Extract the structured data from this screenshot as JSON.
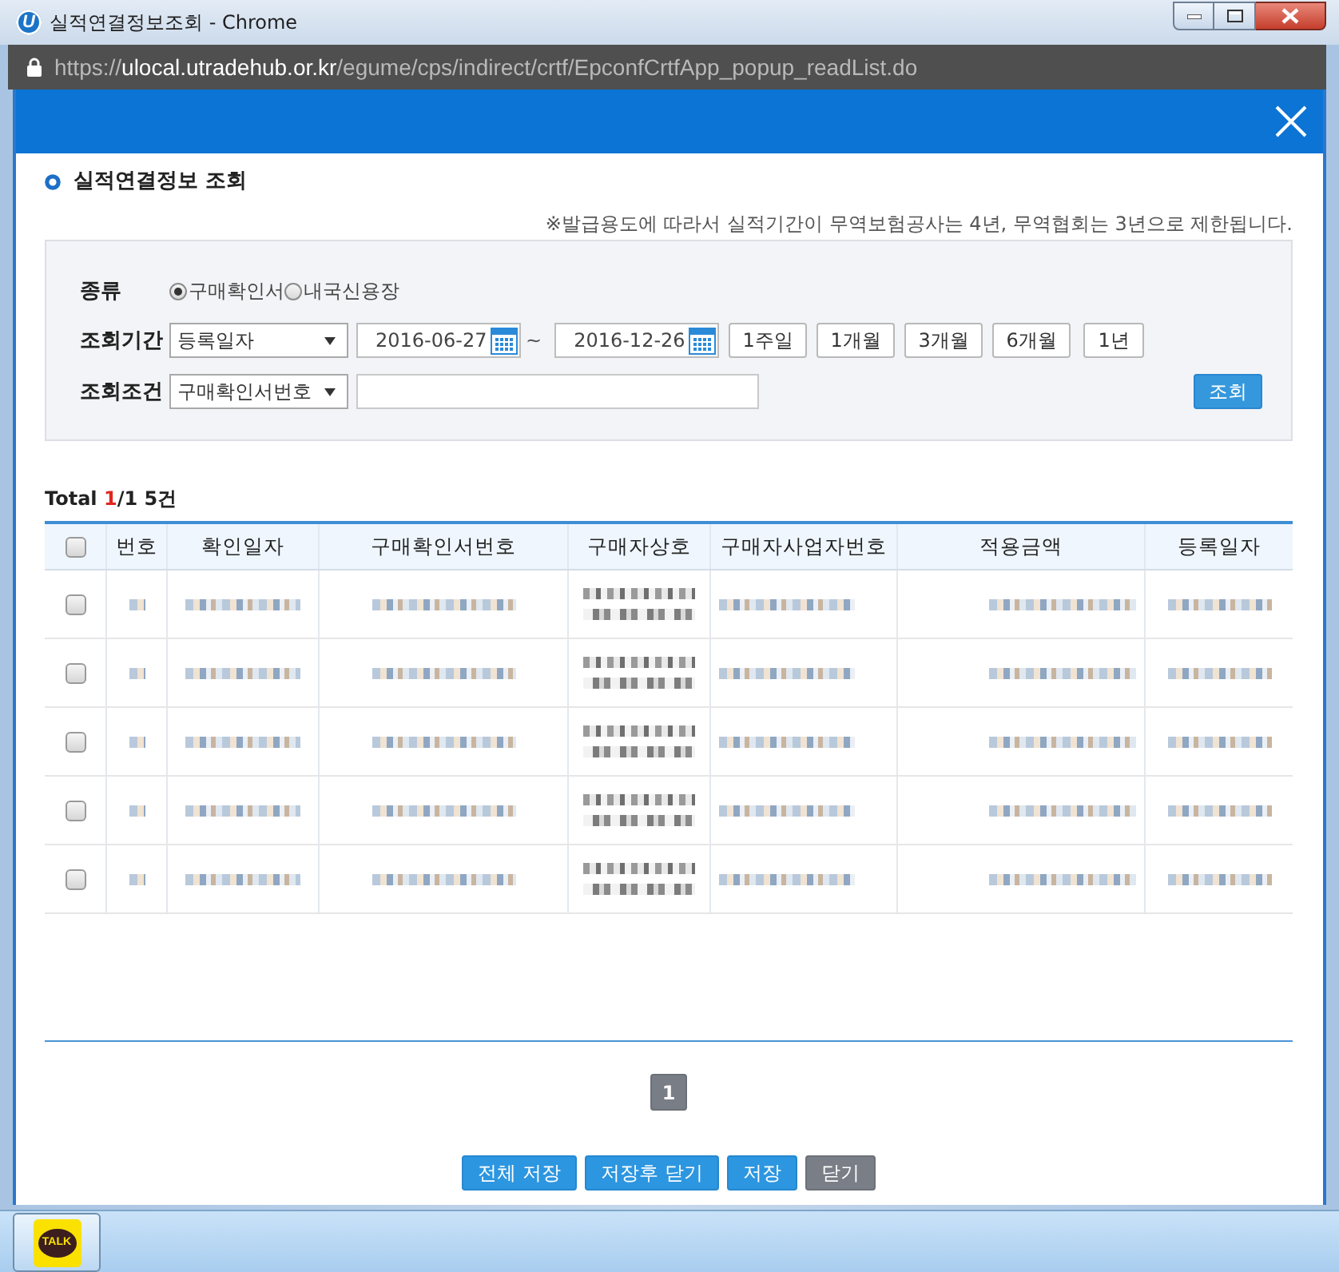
{
  "window": {
    "icon_text": "U",
    "title": "실적연결정보조회 - Chrome"
  },
  "address_bar": {
    "scheme": "https://",
    "host": "ulocal.utradehub.or.kr",
    "path": "/egume/cps/indirect/crtf/EpconfCrtfApp_popup_readList.do"
  },
  "section_title": "실적연결정보 조회",
  "notice": "※발급용도에 따라서 실적기간이 무역보험공사는 4년, 무역협회는 3년으로 제한됩니다.",
  "search": {
    "type": {
      "label": "종류",
      "options": [
        {
          "label": "구매확인서",
          "selected": true
        },
        {
          "label": "내국신용장",
          "selected": false
        }
      ]
    },
    "period": {
      "label": "조회기간",
      "select": "등록일자",
      "from": "2016-06-27",
      "separator": "~",
      "to": "2016-12-26",
      "quick_buttons": [
        "1주일",
        "1개월",
        "3개월",
        "6개월",
        "1년"
      ]
    },
    "condition": {
      "label": "조회조건",
      "select": "구매확인서번호"
    },
    "submit": "조회"
  },
  "result_count": {
    "prefix": "Total",
    "current_page": "1",
    "rest": "/1 5건"
  },
  "table": {
    "select_all": {
      "checked": false
    },
    "columns": [
      "번호",
      "확인일자",
      "구매확인서번호",
      "구매자상호",
      "구매자사업자번호",
      "적용금액",
      "등록일자"
    ],
    "rows": [
      {
        "checked": false
      },
      {
        "checked": false
      },
      {
        "checked": false
      },
      {
        "checked": false
      },
      {
        "checked": false
      }
    ]
  },
  "pagination": {
    "pages": [
      {
        "label": "1",
        "selected": true
      }
    ]
  },
  "buttons": [
    {
      "label": "전체 저장",
      "kind": "primary"
    },
    {
      "label": "저장후 닫기",
      "kind": "primary"
    },
    {
      "label": "저장",
      "kind": "primary"
    },
    {
      "label": "닫기",
      "kind": "secondary"
    }
  ],
  "taskbar": {
    "apps": [
      {
        "label": "TALK"
      }
    ]
  }
}
